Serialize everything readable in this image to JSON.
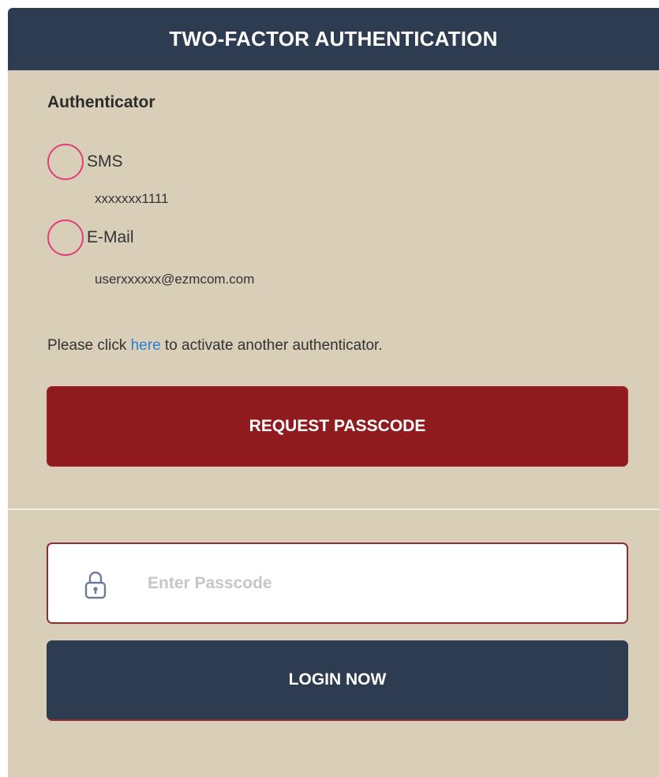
{
  "header": {
    "title": "TWO-FACTOR AUTHENTICATION"
  },
  "authenticator": {
    "heading": "Authenticator",
    "options": [
      {
        "label": "SMS",
        "detail": "xxxxxxx1111",
        "selected": false
      },
      {
        "label": "E-Mail",
        "detail": "userxxxxxx@ezmcom.com",
        "selected": false
      }
    ]
  },
  "hint": {
    "before": "Please click ",
    "link": "here",
    "after": " to activate another authenticator."
  },
  "buttons": {
    "request_passcode": "REQUEST PASSCODE",
    "login_now": "LOGIN NOW"
  },
  "passcode": {
    "placeholder": "Enter Passcode",
    "value": ""
  },
  "colors": {
    "header_bg": "#2d3c51",
    "panel_bg": "#d9cfb9",
    "request_btn": "#901b1f",
    "login_btn": "#2d3c51",
    "radio_ring": "#e0407a",
    "link": "#2a7fd4"
  },
  "icons": {
    "passcode_field": "lock-icon"
  }
}
